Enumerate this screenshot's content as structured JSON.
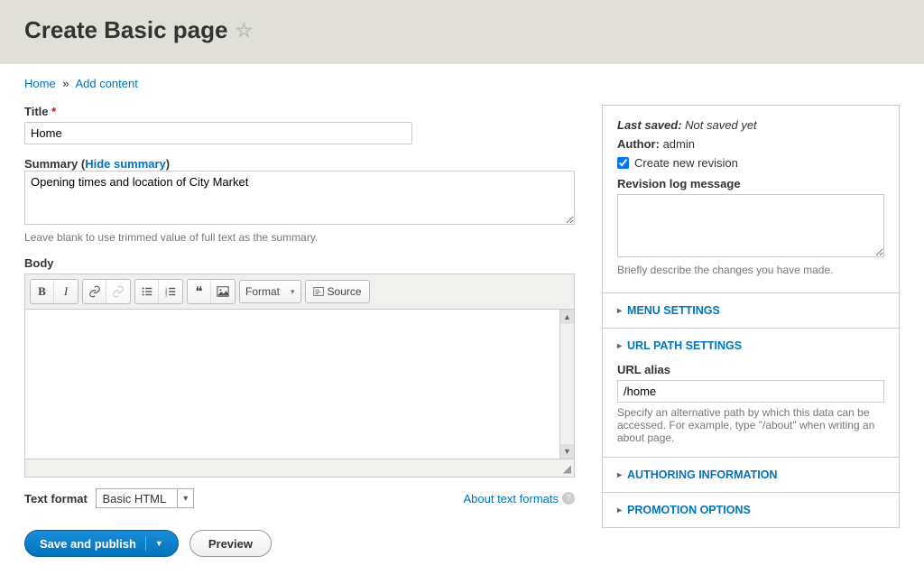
{
  "header": {
    "title": "Create Basic page"
  },
  "breadcrumb": {
    "home": "Home",
    "add_content": "Add content"
  },
  "form": {
    "title_label": "Title",
    "title_value": "Home",
    "summary_label": "Summary",
    "summary_toggle": "Hide summary",
    "summary_value": "Opening times and location of City Market",
    "summary_help": "Leave blank to use trimmed value of full text as the summary.",
    "body_label": "Body",
    "format_dropdown": "Format",
    "source_btn": "Source",
    "text_format_label": "Text format",
    "text_format_value": "Basic HTML",
    "about_formats": "About text formats"
  },
  "actions": {
    "save": "Save and publish",
    "preview": "Preview"
  },
  "sidebar": {
    "last_saved_label": "Last saved:",
    "last_saved_value": "Not saved yet",
    "author_label": "Author:",
    "author_value": "admin",
    "create_revision": "Create new revision",
    "revision_log_label": "Revision log message",
    "revision_log_help": "Briefly describe the changes you have made.",
    "menu_settings": "MENU SETTINGS",
    "url_path_settings": "URL PATH SETTINGS",
    "url_alias_label": "URL alias",
    "url_alias_value": "/home",
    "url_alias_help": "Specify an alternative path by which this data can be accessed. For example, type \"/about\" when writing an about page.",
    "authoring_info": "AUTHORING INFORMATION",
    "promotion_options": "PROMOTION OPTIONS"
  }
}
